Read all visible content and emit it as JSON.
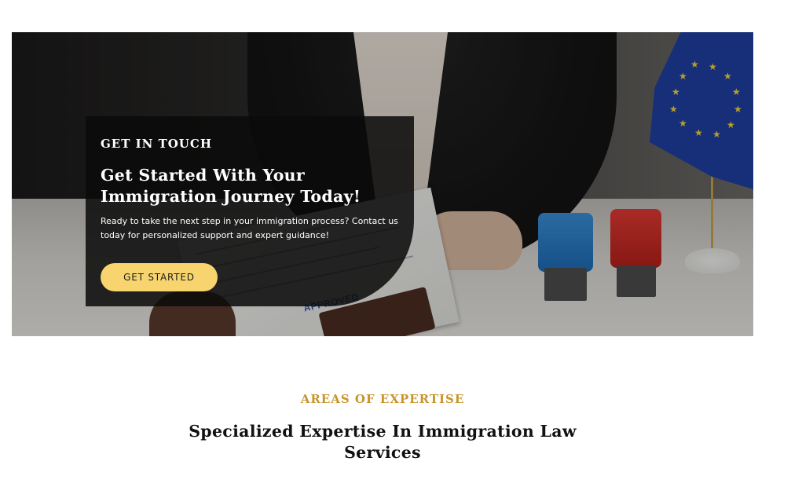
{
  "hero": {
    "eyebrow": "GET IN TOUCH",
    "headline": "Get Started With Your Immigration Journey Today!",
    "description": "Ready to take the next step in your immigration process? Contact us today for personalized support and expert guidance!",
    "cta_label": "GET STARTED",
    "document_stamp_text": "APPROVED",
    "colors": {
      "cta_background": "#f7d46e",
      "card_background": "#0a0a0a"
    }
  },
  "expertise": {
    "eyebrow": "AREAS OF EXPERTISE",
    "title": "Specialized Expertise In Immigration Law Services",
    "colors": {
      "eyebrow": "#c8952c"
    }
  }
}
